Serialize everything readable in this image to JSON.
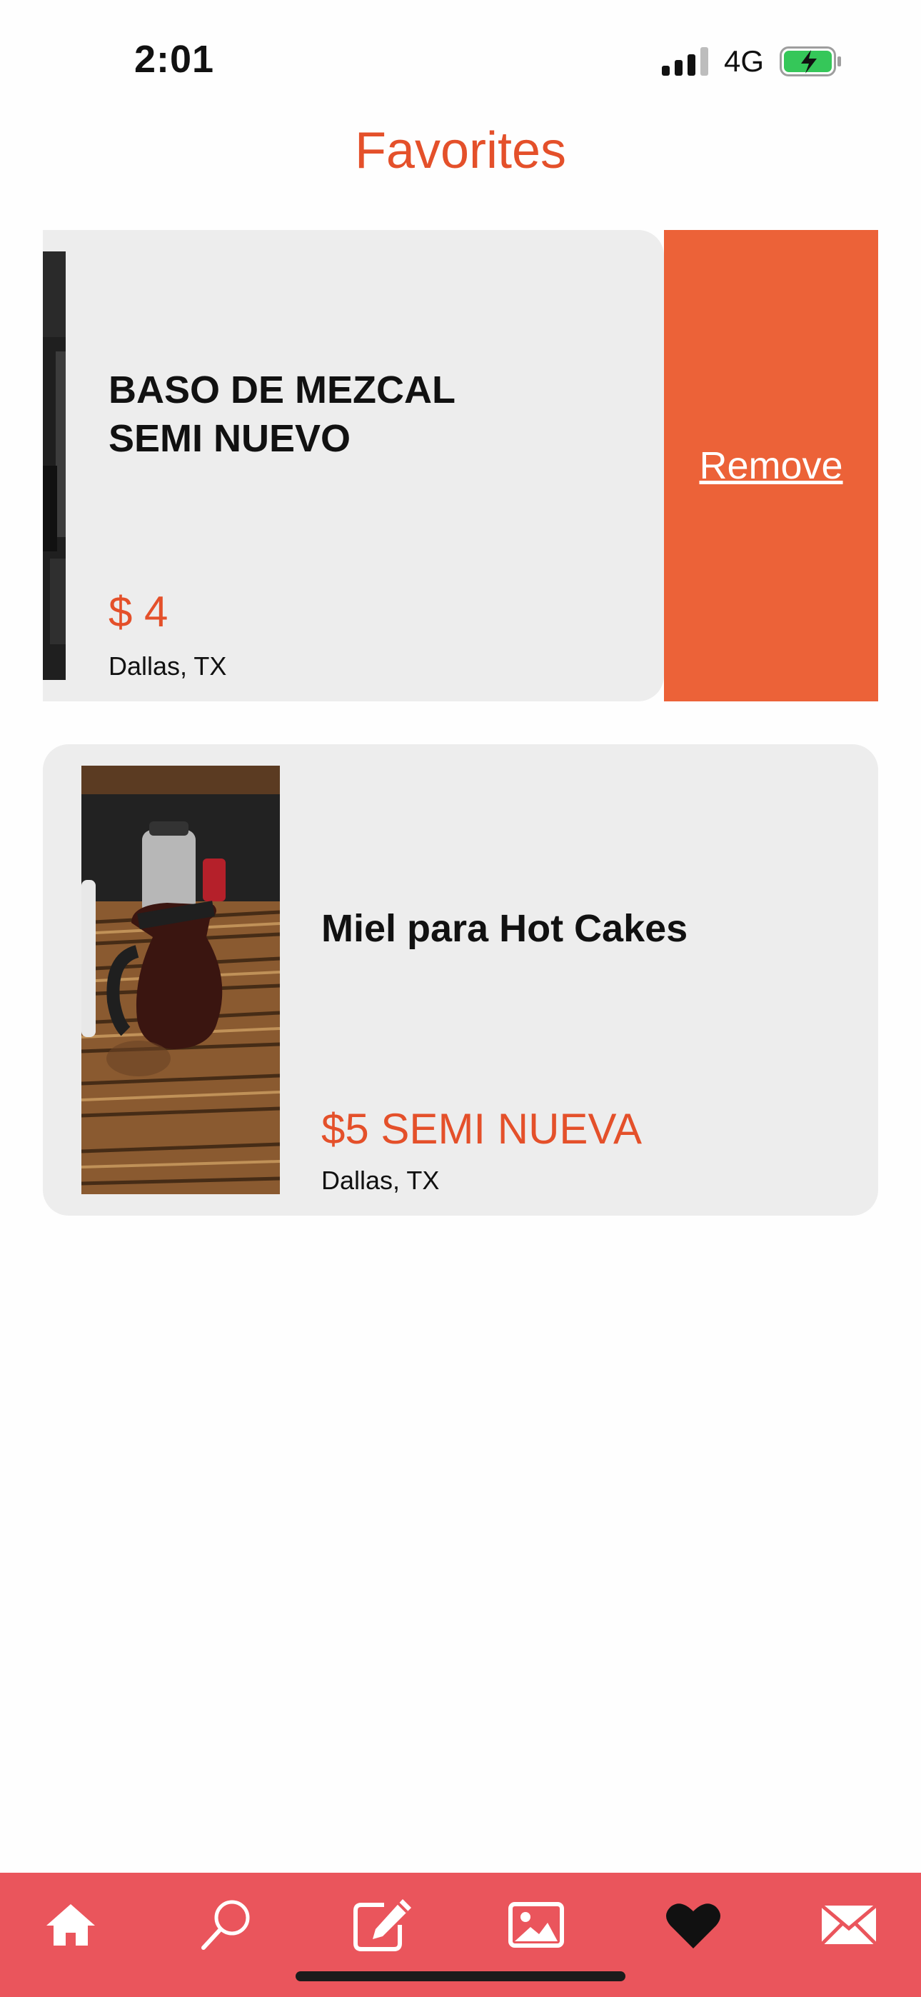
{
  "status_bar": {
    "time": "2:01",
    "network": "4G",
    "battery_color": "#35c759"
  },
  "header": {
    "title": "Favorites",
    "accent_color": "#e4502a"
  },
  "favorites": [
    {
      "title": "BASO DE MEZCAL SEMI NUEVO",
      "price": "$ 4",
      "location": "Dallas, TX",
      "swiped_open": true
    },
    {
      "title": "Miel para Hot Cakes",
      "price": "$5 SEMI NUEVA",
      "location": "Dallas, TX",
      "swiped_open": false
    }
  ],
  "swipe_action": {
    "label": "Remove",
    "color": "#ec6238"
  },
  "tab_bar": {
    "background": "#ea555c",
    "tabs": [
      {
        "icon": "home-icon",
        "active": false
      },
      {
        "icon": "search-icon",
        "active": false
      },
      {
        "icon": "edit-icon",
        "active": false
      },
      {
        "icon": "gallery-icon",
        "active": false
      },
      {
        "icon": "heart-icon",
        "active": true
      },
      {
        "icon": "mail-icon",
        "active": false
      }
    ]
  }
}
